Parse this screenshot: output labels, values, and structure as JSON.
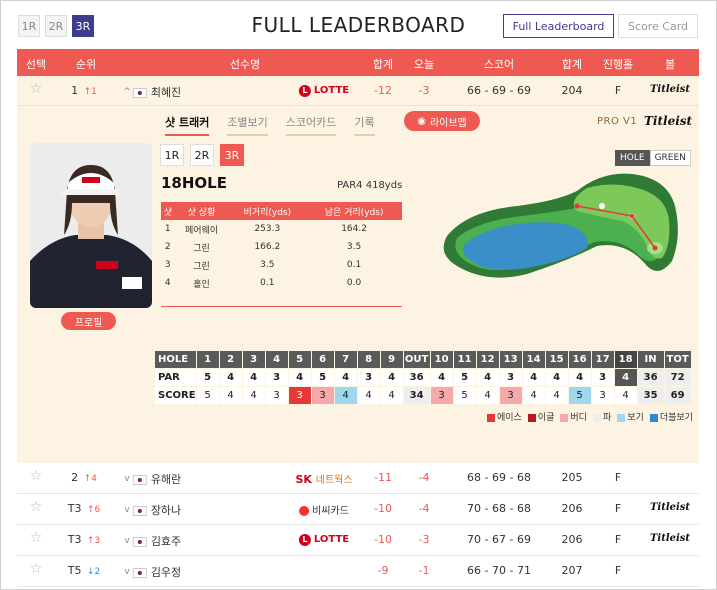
{
  "rounds": [
    "1R",
    "2R",
    "3R"
  ],
  "title": "FULL LEADERBOARD",
  "view_buttons": {
    "full": "Full Leaderboard",
    "card": "Score Card"
  },
  "headers": [
    "선택",
    "순위",
    "선수명",
    "합계",
    "오늘",
    "스코어",
    "합계",
    "진행홀",
    "볼"
  ],
  "expanded_player": {
    "rank": "1",
    "move": "1",
    "name": "최혜진",
    "sponsor": "LOTTE",
    "total": "-12",
    "today": "-3",
    "score": "66 - 69 - 69",
    "sum": "204",
    "hole": "F",
    "ball": "Titleist"
  },
  "sub_tabs": [
    "샷 트래커",
    "조별보기",
    "스코어카드",
    "기록"
  ],
  "live_button": "라이브맵",
  "ball_brand": {
    "model": "PRO V1",
    "brand": "Titleist"
  },
  "profile_button": "프로필",
  "shot_rounds": [
    "1R",
    "2R",
    "3R"
  ],
  "hole": {
    "title": "18HOLE",
    "par_info": "PAR4 418yds"
  },
  "shot_headers": [
    "샷",
    "샷 상황",
    "비거리(yds)",
    "남은 거리(yds)"
  ],
  "shots": [
    [
      "1",
      "페어웨이",
      "253.3",
      "164.2"
    ],
    [
      "2",
      "그린",
      "166.2",
      "3.5"
    ],
    [
      "3",
      "그린",
      "3.5",
      "0.1"
    ],
    [
      "4",
      "홀인",
      "0.1",
      "0.0"
    ]
  ],
  "view_toggle": [
    "HOLE",
    "GREEN"
  ],
  "scorecard": {
    "holes": [
      "HOLE",
      "1",
      "2",
      "3",
      "4",
      "5",
      "6",
      "7",
      "8",
      "9",
      "OUT",
      "10",
      "11",
      "12",
      "13",
      "14",
      "15",
      "16",
      "17",
      "18",
      "IN",
      "TOT"
    ],
    "par": [
      "PAR",
      "5",
      "4",
      "4",
      "3",
      "4",
      "5",
      "4",
      "3",
      "4",
      "36",
      "4",
      "5",
      "4",
      "3",
      "4",
      "4",
      "4",
      "3",
      "4",
      "36",
      "72"
    ],
    "score": [
      "SCORE",
      "5",
      "4",
      "4",
      "3",
      "3",
      "3",
      "4",
      "4",
      "4",
      "34",
      "3",
      "5",
      "4",
      "3",
      "4",
      "4",
      "5",
      "3",
      "4",
      "35",
      "69"
    ]
  },
  "legend": [
    "에이스",
    "이글",
    "버디",
    "파",
    "보기",
    "더블보기"
  ],
  "legend_colors": [
    "#e53935",
    "#b71c1c",
    "#f5a9a9",
    "#eeeeee",
    "#9fd8ec",
    "#2a8ad4"
  ],
  "rows": [
    {
      "rank": "2",
      "move": "4",
      "dir": "up",
      "name": "유해란",
      "sponsor": "SK",
      "sponsor_sub": "네트웍스",
      "total": "-11",
      "today": "-4",
      "score": "68 - 69 - 68",
      "sum": "205",
      "hole": "F",
      "ball": ""
    },
    {
      "rank": "T3",
      "move": "6",
      "dir": "up",
      "name": "장하나",
      "sponsor": "비씨카드",
      "sponsor_sub": "",
      "total": "-10",
      "today": "-4",
      "score": "70 - 68 - 68",
      "sum": "206",
      "hole": "F",
      "ball": "Titleist"
    },
    {
      "rank": "T3",
      "move": "3",
      "dir": "up",
      "name": "김효주",
      "sponsor": "LOTTE",
      "sponsor_sub": "",
      "total": "-10",
      "today": "-3",
      "score": "70 - 67 - 69",
      "sum": "206",
      "hole": "F",
      "ball": "Titleist"
    },
    {
      "rank": "T5",
      "move": "2",
      "dir": "down",
      "name": "김우정",
      "sponsor": "",
      "sponsor_sub": "",
      "total": "-9",
      "today": "-1",
      "score": "66 - 70 - 71",
      "sum": "207",
      "hole": "F",
      "ball": ""
    }
  ]
}
